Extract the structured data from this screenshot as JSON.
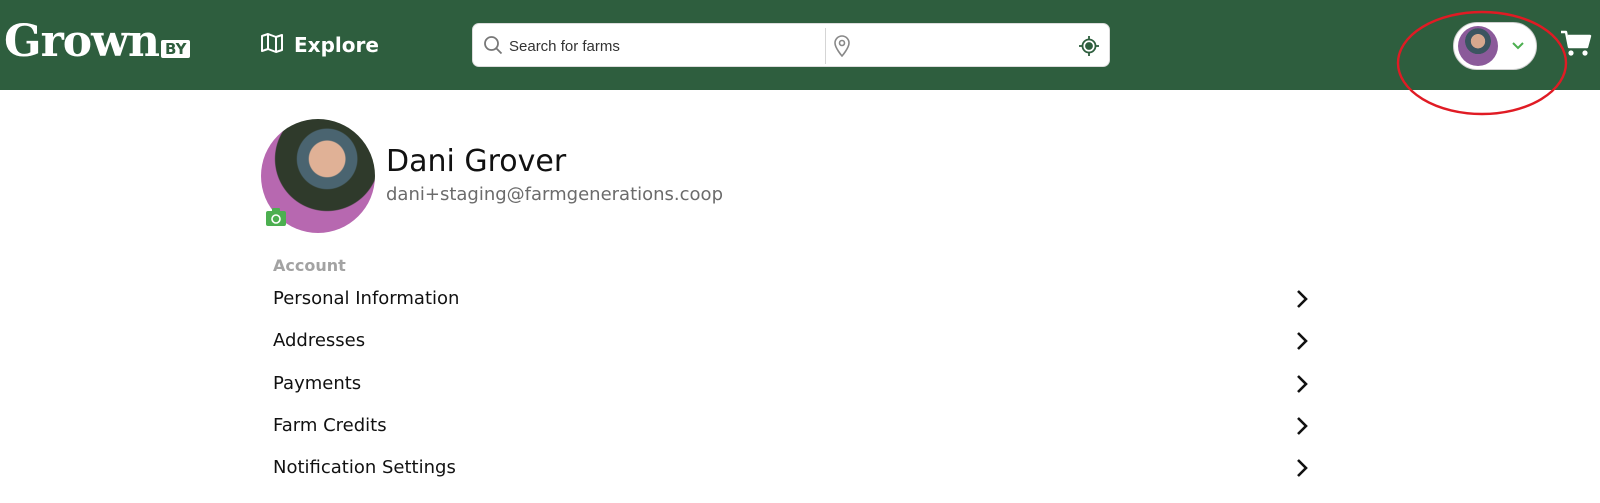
{
  "header": {
    "logo_main": "Grown",
    "logo_by": "BY",
    "explore_label": "Explore",
    "search_placeholder": "Search for farms",
    "location_placeholder": "",
    "icons": {
      "explore": "map-icon",
      "search": "search-icon",
      "location": "location-pin-icon",
      "locate": "crosshair-icon",
      "profile_menu": "chevron-down-icon",
      "cart": "cart-icon"
    },
    "colors": {
      "bar": "#2e5e3e",
      "accent_green": "#4caf50",
      "highlight_circle": "#e01b24"
    }
  },
  "profile": {
    "name": "Dani Grover",
    "email": "dani+staging@farmgenerations.coop"
  },
  "account": {
    "section_label": "Account",
    "items": [
      {
        "label": "Personal Information"
      },
      {
        "label": "Addresses"
      },
      {
        "label": "Payments"
      },
      {
        "label": "Farm Credits"
      },
      {
        "label": "Notification Settings"
      }
    ]
  }
}
